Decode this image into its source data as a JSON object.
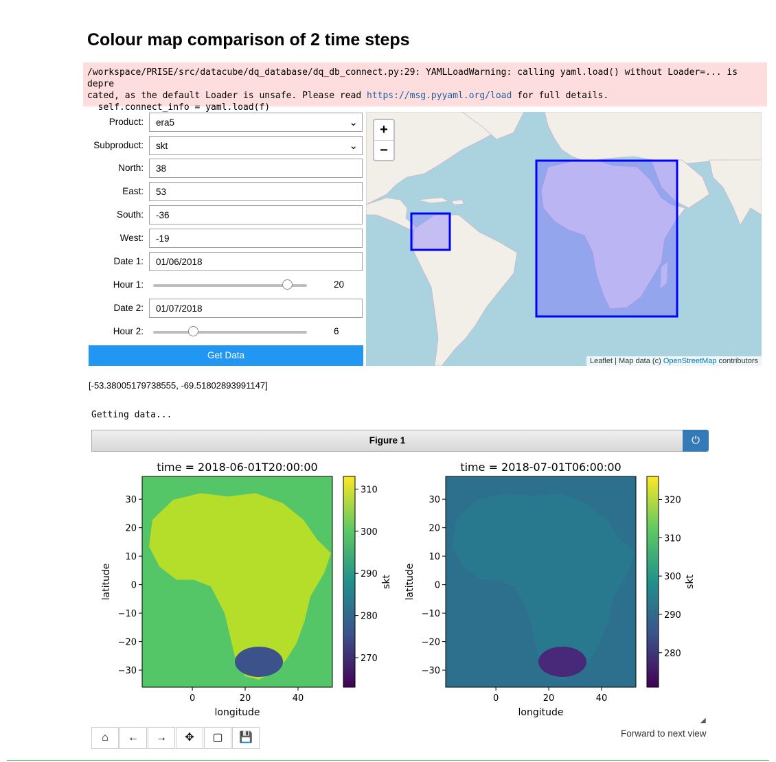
{
  "title": "Colour map comparison of 2 time steps",
  "warning": {
    "line1": "/workspace/PRISE/src/datacube/dq_database/dq_db_connect.py:29: YAMLLoadWarning: calling yaml.load() without Loader=... is depre",
    "line2a": "cated, as the default Loader is unsafe. Please read ",
    "link": "https://msg.pyyaml.org/load",
    "line2b": " for full details.",
    "line3": "  self.connect_info = yaml.load(f)"
  },
  "form": {
    "product_label": "Product:",
    "product_value": "era5",
    "subproduct_label": "Subproduct:",
    "subproduct_value": "skt",
    "north_label": "North:",
    "north_value": "38",
    "east_label": "East:",
    "east_value": "53",
    "south_label": "South:",
    "south_value": "-36",
    "west_label": "West:",
    "west_value": "-19",
    "date1_label": "Date 1:",
    "date1_value": "01/06/2018",
    "hour1_label": "Hour 1:",
    "hour1_value": "20",
    "hour1_fraction": 0.87,
    "date2_label": "Date 2:",
    "date2_value": "01/07/2018",
    "hour2_label": "Hour 2:",
    "hour2_value": "6",
    "hour2_fraction": 0.26,
    "get_data_label": "Get Data"
  },
  "map": {
    "zoom_in": "+",
    "zoom_out": "−",
    "attrib_prefix": "Leaflet | Map data (c) ",
    "attrib_link": "OpenStreetMap",
    "attrib_suffix": " contributors"
  },
  "coords_text": "[-53.38005179738555, -69.51802893991147]",
  "status_text": "Getting data...",
  "figure": {
    "title": "Figure 1",
    "power_icon": "power-icon",
    "status_right": "Forward to next view",
    "toolbar": [
      "home-icon",
      "back-arrow-icon",
      "forward-arrow-icon",
      "move-icon",
      "zoom-rect-icon",
      "save-icon"
    ]
  },
  "chart_data": [
    {
      "type": "heatmap",
      "title": "time = 2018-06-01T20:00:00",
      "xlabel": "longitude",
      "ylabel": "latitude",
      "colorbar_label": "skt",
      "xticks": [
        0,
        20,
        40
      ],
      "yticks": [
        30,
        20,
        10,
        0,
        -10,
        -20,
        -30
      ],
      "xlim": [
        -19,
        53
      ],
      "ylim": [
        -36,
        38
      ],
      "colorbar_ticks": [
        310,
        300,
        290,
        280,
        270
      ],
      "colorbar_range": [
        263,
        313
      ]
    },
    {
      "type": "heatmap",
      "title": "time = 2018-07-01T06:00:00",
      "xlabel": "longitude",
      "ylabel": "latitude",
      "colorbar_label": "skt",
      "xticks": [
        0,
        20,
        40
      ],
      "yticks": [
        30,
        20,
        10,
        0,
        -10,
        -20,
        -30
      ],
      "xlim": [
        -19,
        53
      ],
      "ylim": [
        -36,
        38
      ],
      "colorbar_ticks": [
        320,
        310,
        300,
        290,
        280
      ],
      "colorbar_range": [
        271,
        326
      ]
    }
  ]
}
